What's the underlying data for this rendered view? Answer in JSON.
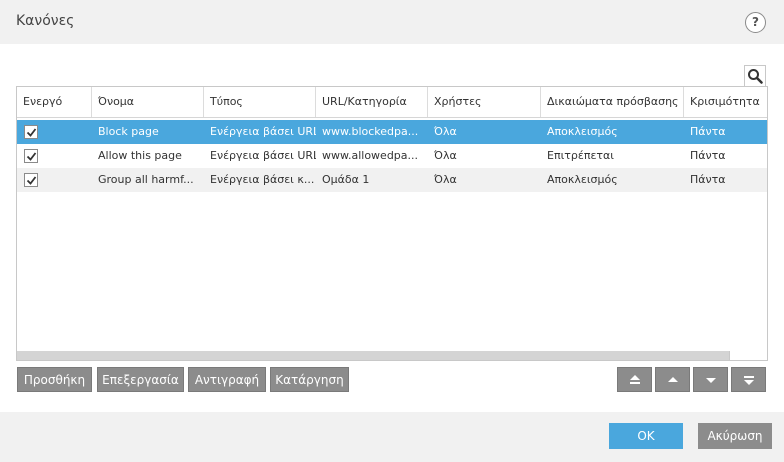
{
  "window": {
    "title": "Κανόνες",
    "help_label": "?"
  },
  "table": {
    "columns": [
      "Ενεργό",
      "Όνομα",
      "Τύπος",
      "URL/Κατηγορία",
      "Χρήστες",
      "Δικαιώματα πρόσβασης",
      "Κρισιμότητα"
    ],
    "rows": [
      {
        "active": true,
        "name": "Block page",
        "type": "Ενέργεια βάσει URL",
        "url": "www.blockedpa...",
        "users": "Όλα",
        "access": "Αποκλεισμός",
        "severity": "Πάντα",
        "selected": true
      },
      {
        "active": true,
        "name": "Allow this page",
        "type": "Ενέργεια βάσει URL",
        "url": "www.allowedpa...",
        "users": "Όλα",
        "access": "Επιτρέπεται",
        "severity": "Πάντα",
        "selected": false
      },
      {
        "active": true,
        "name": "Group all harmf...",
        "type": "Ενέργεια βάσει κ...",
        "url": "Ομάδα 1",
        "users": "Όλα",
        "access": "Αποκλεισμός",
        "severity": "Πάντα",
        "selected": false
      }
    ]
  },
  "actions": {
    "add": "Προσθήκη",
    "edit": "Επεξεργασία",
    "copy": "Αντιγραφή",
    "remove": "Κατάργηση"
  },
  "footer": {
    "ok": "OK",
    "cancel": "Ακύρωση"
  },
  "icons": [
    "search-icon",
    "move-top-icon",
    "move-up-icon",
    "move-down-icon",
    "move-bottom-icon",
    "checkbox-checked-icon"
  ],
  "colors": {
    "accent": "#4aa7dd",
    "button_gray": "#8c8c8c"
  }
}
